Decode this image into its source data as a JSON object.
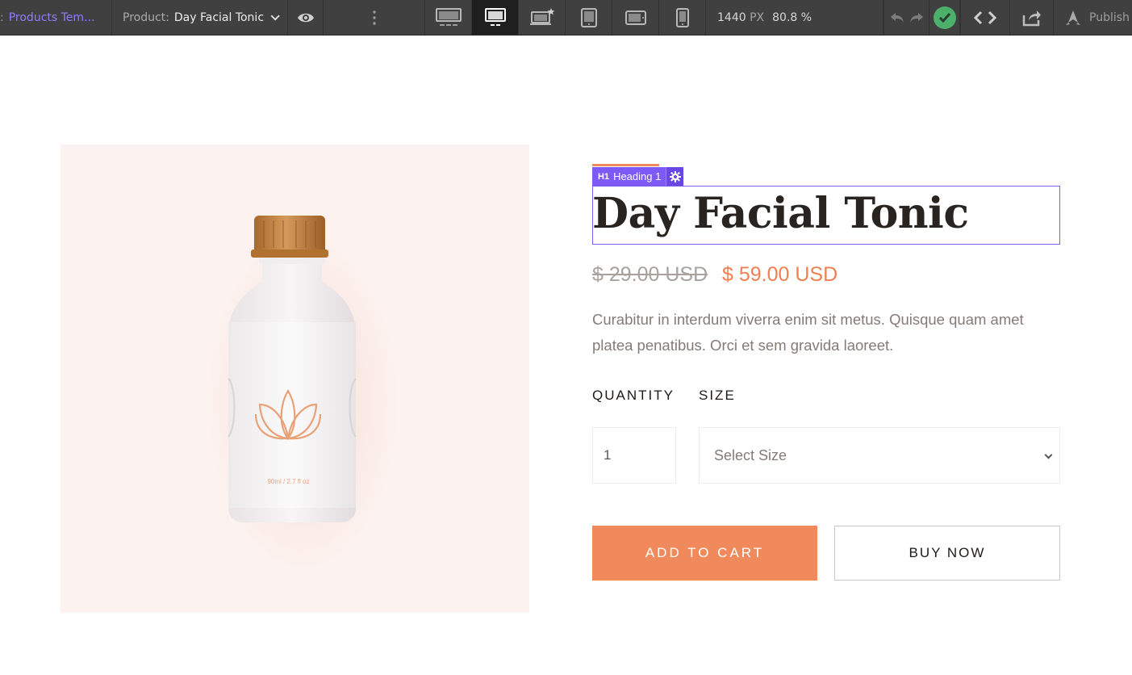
{
  "toolbar": {
    "page_name": "Products Tem...",
    "product_label": "Product:",
    "product_value": "Day Facial Tonic",
    "width_value": "1440",
    "width_unit": "PX",
    "zoom_value": "80.8 %",
    "publish_label": "Publish",
    "accent_color": "#8f7bff",
    "status_color": "#4caf6a"
  },
  "canvas": {
    "selection": {
      "tag_type": "H1",
      "tag_label": "Heading 1",
      "color": "#7d5af5"
    },
    "product": {
      "title": "Day Facial Tonic",
      "price_old": "$ 29.00 USD",
      "price_new": "$ 59.00 USD",
      "description": "Curabitur in interdum viverra enim sit metus. Quisque quam amet platea penatibus. Orci et sem gravida laoreet.",
      "bottle_label": "90ml / 2.7 fl oz"
    },
    "form": {
      "quantity_label": "QUANTITY",
      "quantity_value": "1",
      "size_label": "SIZE",
      "size_selected": "Select Size",
      "add_to_cart": "ADD TO CART",
      "buy_now": "BUY NOW"
    },
    "colors": {
      "accent": "#ef8a5d",
      "heading": "#2a2420",
      "body_text": "#857b76",
      "image_bg": "#fcf2ef"
    }
  }
}
